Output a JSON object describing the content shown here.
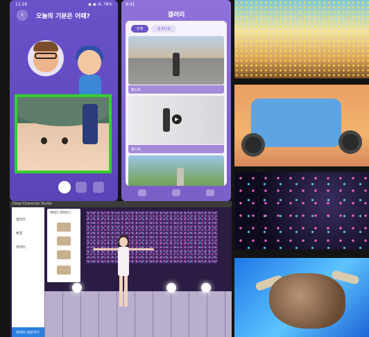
{
  "phone_mood": {
    "status_time": "11:26",
    "status_right": "◆ ◉ ⁂ 78%",
    "title": "오늘의 기분은 어때?",
    "back_icon": "chevron-left-icon"
  },
  "phone_gallery": {
    "status_time": "8:41",
    "title": "갤러리",
    "tabs": [
      "전체",
      "내 비디오"
    ],
    "captions": [
      "페스트",
      "페스트"
    ]
  },
  "dcs": {
    "window_title": "Deep Character Studio",
    "sidebar_items": [
      "갤러리",
      "배경",
      "캐릭터"
    ],
    "sidebar_button": "캐릭터 생성하기",
    "list_title": "캐릭터 레퍼런스"
  }
}
